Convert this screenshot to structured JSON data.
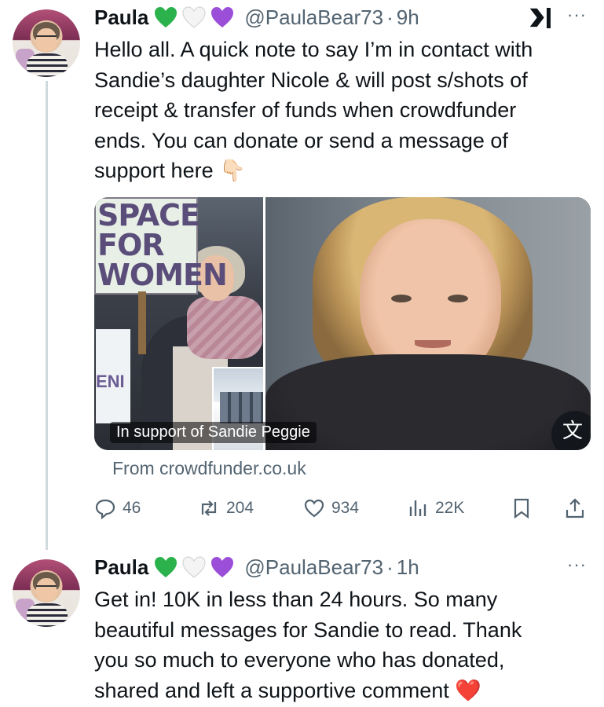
{
  "tweets": [
    {
      "name": "Paula",
      "badges": [
        "green-heart",
        "white-heart",
        "purple-heart"
      ],
      "handle": "@PaulaBear73",
      "separator": "·",
      "time": "9h",
      "text_lines": [
        "Hello all.  A quick note to say I’m in contact with",
        "Sandie’s daughter Nicole & will post s/shots of",
        "receipt & transfer of funds when crowdfunder",
        "ends.  You can donate or send a message of",
        "support here"
      ],
      "text_emoji": "👇🏻",
      "card": {
        "sign_text": "SPACE\nFOR\nWOMEN",
        "sign2_text": "ENI",
        "caption": "In support of Sandie Peggie",
        "translate_glyph": "文"
      },
      "source": "From crowdfunder.co.uk",
      "actions": {
        "replies": "46",
        "reposts": "204",
        "likes": "934",
        "views": "22K"
      },
      "more_label": "···"
    },
    {
      "name": "Paula",
      "badges": [
        "green-heart",
        "white-heart",
        "purple-heart"
      ],
      "handle": "@PaulaBear73",
      "separator": "·",
      "time": "1h",
      "text_lines": [
        "Get in!  10K in less than 24 hours.    So many",
        "beautiful messages for Sandie to read.   Thank",
        "you so much to everyone who has donated,",
        "shared and left a supportive comment"
      ],
      "text_emoji": "❤️",
      "more_label": "···"
    }
  ],
  "colors": {
    "text": "#0f1419",
    "muted": "#536471",
    "thread_line": "#cfd9de",
    "green_heart": "#2bb24c",
    "purple_heart": "#9b4fd9",
    "red_heart": "#e0182d"
  },
  "icons": [
    "reply-icon",
    "repost-icon",
    "like-icon",
    "views-icon",
    "bookmark-icon",
    "share-icon",
    "x-grok-icon",
    "more-icon"
  ]
}
